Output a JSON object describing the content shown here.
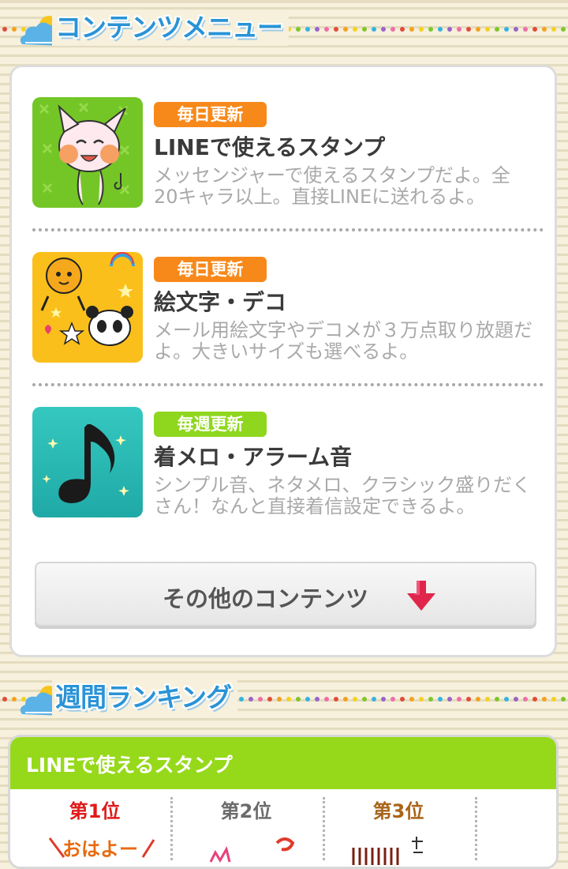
{
  "menu_section": {
    "title": "コンテンツメニュー"
  },
  "items": [
    {
      "badge": "毎日更新",
      "title": "LINEで使えるスタンプ",
      "desc": "メッセンジャーで使えるスタンプだよ。全20キャラ以上。直接LINEに送れるよ。"
    },
    {
      "badge": "毎日更新",
      "title": "絵文字・デコ",
      "desc": "メール用絵文字やデコメが３万点取り放題だよ。大きいサイズも選べるよ。"
    },
    {
      "badge": "毎週更新",
      "title": "着メロ・アラーム音",
      "desc": "シンプル音、ネタメロ、クラシック盛りだくさん！なんと直接着信設定できるよ。"
    }
  ],
  "more_button": {
    "label": "その他のコンテンツ"
  },
  "ranking_section": {
    "title": "週間ランキング",
    "category": "LINEで使えるスタンプ",
    "ranks": [
      "第1位",
      "第2位",
      "第3位"
    ],
    "rank1_sticker_text": "おはよー"
  },
  "colors": {
    "badge_daily": "#f7891b",
    "badge_weekly": "#8fd71e",
    "ranking_header": "#96d91b",
    "section_title": "#2a93d6"
  }
}
